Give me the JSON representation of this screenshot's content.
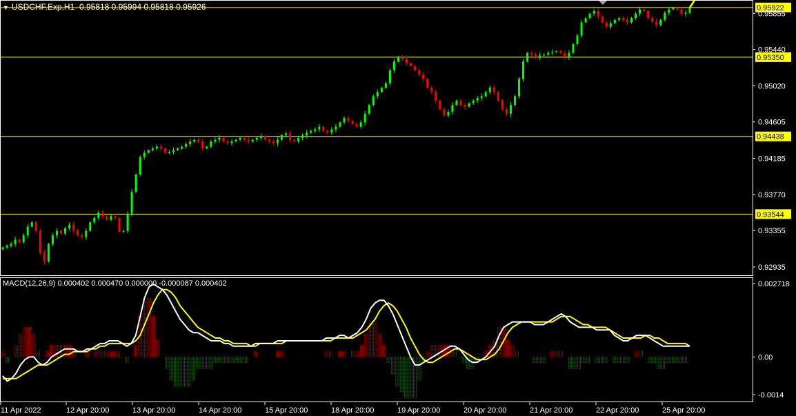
{
  "header": {
    "symbol": "USDCHF.Exp,H1",
    "ohlc": "0.95818 0.95994 0.95818 0.95926",
    "menu_glyph": "▼"
  },
  "macd_header": {
    "label": "MACD(12,26,9) 0.000402 0.000470 0.000000 -0.000087 0.000402"
  },
  "colors": {
    "background": "#000000",
    "bull_candle": "#00ff00",
    "bear_candle": "#ff0000",
    "level_line": "#ffff00",
    "macd_line": "#ffffff",
    "signal_line": "#ffff00",
    "hist_pos": "#ff0000",
    "hist_neg": "#00aa00",
    "axis": "#ffffff"
  },
  "chart_data": [
    {
      "type": "candlestick",
      "title": "USDCHF.Exp,H1",
      "y_ticks": [
        "0.95855",
        "0.95440",
        "0.95020",
        "0.94605",
        "0.94185",
        "0.93770",
        "0.93355",
        "0.92935"
      ],
      "y_tick_values": [
        0.95855,
        0.9544,
        0.9502,
        0.94605,
        0.94185,
        0.9377,
        0.93355,
        0.92935
      ],
      "ylim": [
        0.9284,
        0.96
      ],
      "x_ticks": [
        "11 Apr 2022",
        "12 Apr 20:00",
        "13 Apr 20:00",
        "14 Apr 20:00",
        "15 Apr 20:00",
        "18 Apr 20:00",
        "19 Apr 20:00",
        "20 Apr 20:00",
        "21 Apr 20:00",
        "22 Apr 20:00",
        "25 Apr 20:00"
      ],
      "levels": [
        0.95922,
        0.9535,
        0.94438,
        0.93544
      ],
      "level_labels": [
        "0.95922",
        "0.95350",
        "0.94438",
        "0.93544"
      ],
      "close_path": [
        0.9316,
        0.9318,
        0.932,
        0.9325,
        0.9322,
        0.933,
        0.934,
        0.9345,
        0.9335,
        0.931,
        0.93,
        0.932,
        0.933,
        0.9335,
        0.9332,
        0.9338,
        0.9342,
        0.9336,
        0.933,
        0.9328,
        0.9335,
        0.9345,
        0.935,
        0.9356,
        0.9352,
        0.9348,
        0.9352,
        0.935,
        0.9334,
        0.9335,
        0.9355,
        0.938,
        0.94,
        0.942,
        0.9425,
        0.9428,
        0.943,
        0.9432,
        0.943,
        0.9425,
        0.9426,
        0.9428,
        0.943,
        0.9432,
        0.9435,
        0.9438,
        0.944,
        0.9438,
        0.943,
        0.9432,
        0.9438,
        0.944,
        0.9442,
        0.9438,
        0.9436,
        0.9438,
        0.944,
        0.9442,
        0.944,
        0.9438,
        0.944,
        0.9442,
        0.9444,
        0.944,
        0.9438,
        0.9436,
        0.944,
        0.9445,
        0.9447,
        0.944,
        0.9438,
        0.9442,
        0.9445,
        0.9448,
        0.945,
        0.9452,
        0.9455,
        0.945,
        0.9448,
        0.9452,
        0.9455,
        0.946,
        0.9465,
        0.9462,
        0.9458,
        0.9455,
        0.946,
        0.947,
        0.948,
        0.949,
        0.9495,
        0.95,
        0.9505,
        0.952,
        0.953,
        0.9535,
        0.9533,
        0.9528,
        0.9525,
        0.952,
        0.9515,
        0.951,
        0.95,
        0.9495,
        0.9485,
        0.9475,
        0.9468,
        0.9472,
        0.948,
        0.9485,
        0.948,
        0.9478,
        0.9482,
        0.9485,
        0.9488,
        0.949,
        0.9495,
        0.95,
        0.9495,
        0.9485,
        0.9475,
        0.947,
        0.948,
        0.949,
        0.951,
        0.953,
        0.954,
        0.9538,
        0.9535,
        0.9537,
        0.9538,
        0.954,
        0.9541,
        0.9542,
        0.954,
        0.9535,
        0.954,
        0.955,
        0.956,
        0.9575,
        0.958,
        0.9585,
        0.9588,
        0.9582,
        0.9575,
        0.957,
        0.9574,
        0.9578,
        0.958,
        0.9578,
        0.9575,
        0.958,
        0.9585,
        0.959,
        0.9588,
        0.958,
        0.9576,
        0.9572,
        0.9578,
        0.9586,
        0.959,
        0.9592,
        0.959,
        0.9585,
        0.9586,
        0.9592
      ]
    },
    {
      "type": "line",
      "title": "MACD(12,26,9)",
      "y_ticks": [
        "0.002718",
        "0.00",
        "-0.0014"
      ],
      "y_tick_values": [
        0.002718,
        0.0,
        -0.0014
      ],
      "ylim": [
        -0.00155,
        0.00285
      ],
      "series": [
        {
          "name": "MACD",
          "values": [
            -0.0007,
            -0.0009,
            -0.0008,
            -0.0006,
            -0.0003,
            -0.0001,
            0.0,
            0.0,
            -0.0002,
            -0.0003,
            -0.0002,
            0.0,
            0.0001,
            0.0002,
            0.0003,
            0.0003,
            0.0003,
            0.0002,
            0.0002,
            0.0003,
            0.0003,
            0.0004,
            0.0005,
            0.0005,
            0.0006,
            0.0006,
            0.0006,
            0.0005,
            0.0004,
            0.0005,
            0.0008,
            0.0015,
            0.0022,
            0.0026,
            0.0027,
            0.0026,
            0.0025,
            0.0023,
            0.002,
            0.0017,
            0.0014,
            0.0012,
            0.001,
            0.0009,
            0.0009,
            0.0008,
            0.0007,
            0.0006,
            0.0006,
            0.0006,
            0.0005,
            0.0005,
            0.0004,
            0.0004,
            0.0004,
            0.0004,
            0.0004,
            0.0005,
            0.0005,
            0.0005,
            0.0005,
            0.0005,
            0.0006,
            0.0006,
            0.0006,
            0.0006,
            0.0006,
            0.0006,
            0.0006,
            0.0006,
            0.0006,
            0.0006,
            0.0006,
            0.0007,
            0.0007,
            0.0007,
            0.0008,
            0.0008,
            0.0007,
            0.0008,
            0.0009,
            0.0011,
            0.0014,
            0.0018,
            0.002,
            0.0021,
            0.0021,
            0.0019,
            0.0016,
            0.0012,
            0.0008,
            0.0004,
            0.0,
            -0.0003,
            -0.0003,
            -0.0002,
            -0.0001,
            0.0,
            0.0001,
            0.0002,
            0.0003,
            0.0004,
            0.0004,
            0.0003,
            0.0001,
            -0.0001,
            -0.0002,
            -0.0002,
            -0.0001,
            0.0,
            0.0002,
            0.0004,
            0.0008,
            0.0011,
            0.0012,
            0.0013,
            0.0013,
            0.0013,
            0.0013,
            0.0013,
            0.0012,
            0.0012,
            0.0012,
            0.0013,
            0.0014,
            0.0015,
            0.0016,
            0.0015,
            0.0013,
            0.0012,
            0.0011,
            0.0011,
            0.0011,
            0.0011,
            0.001,
            0.001,
            0.001,
            0.001,
            0.0008,
            0.0007,
            0.0006,
            0.0006,
            0.0007,
            0.0008,
            0.0008,
            0.0008,
            0.0007,
            0.0006,
            0.0005,
            0.0004,
            0.0004,
            0.0004,
            0.0004,
            0.0004,
            0.0004,
            0.0004
          ]
        },
        {
          "name": "Signal",
          "values": [
            -0.0008,
            -0.0008,
            -0.0008,
            -0.0008,
            -0.0007,
            -0.0006,
            -0.0005,
            -0.0004,
            -0.0003,
            -0.0003,
            -0.0003,
            -0.0002,
            -0.0001,
            0.0,
            0.0001,
            0.0001,
            0.0002,
            0.0002,
            0.0002,
            0.0002,
            0.0003,
            0.0003,
            0.0004,
            0.0004,
            0.0005,
            0.0005,
            0.0005,
            0.0005,
            0.0005,
            0.0005,
            0.0006,
            0.0008,
            0.0012,
            0.0016,
            0.002,
            0.0023,
            0.0025,
            0.0025,
            0.0024,
            0.0022,
            0.0019,
            0.0017,
            0.0015,
            0.0013,
            0.0011,
            0.001,
            0.0009,
            0.0008,
            0.0007,
            0.0007,
            0.0006,
            0.0006,
            0.0005,
            0.0005,
            0.0005,
            0.0005,
            0.0004,
            0.0004,
            0.0005,
            0.0005,
            0.0005,
            0.0005,
            0.0005,
            0.0005,
            0.0006,
            0.0006,
            0.0006,
            0.0006,
            0.0006,
            0.0006,
            0.0006,
            0.0006,
            0.0006,
            0.0006,
            0.0006,
            0.0007,
            0.0007,
            0.0007,
            0.0007,
            0.0007,
            0.0008,
            0.0009,
            0.001,
            0.0012,
            0.0014,
            0.0017,
            0.0019,
            0.002,
            0.0019,
            0.0017,
            0.0014,
            0.0011,
            0.0007,
            0.0004,
            0.0001,
            -0.0001,
            -0.0002,
            -0.0002,
            -0.0001,
            0.0,
            0.0001,
            0.0002,
            0.0003,
            0.0003,
            0.0002,
            0.0001,
            0.0,
            -0.0001,
            -0.0001,
            -0.0001,
            0.0,
            0.0001,
            0.0003,
            0.0006,
            0.0009,
            0.0011,
            0.0012,
            0.0013,
            0.0013,
            0.0013,
            0.0013,
            0.0013,
            0.0013,
            0.0013,
            0.0013,
            0.0014,
            0.0015,
            0.0015,
            0.0015,
            0.0014,
            0.0013,
            0.0012,
            0.0012,
            0.0011,
            0.0011,
            0.0011,
            0.0011,
            0.001,
            0.0009,
            0.0008,
            0.0007,
            0.0007,
            0.0007,
            0.0007,
            0.0007,
            0.0008,
            0.0008,
            0.0007,
            0.0007,
            0.0006,
            0.0005,
            0.0005,
            0.0005,
            0.0005,
            0.0005,
            0.0004
          ]
        }
      ]
    }
  ]
}
